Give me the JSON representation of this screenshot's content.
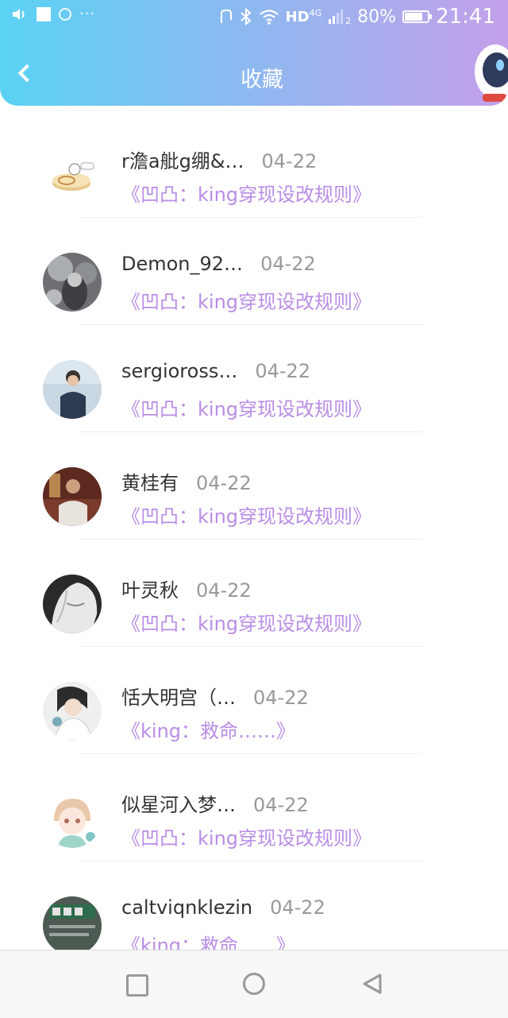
{
  "status_bar": {
    "network": "HD",
    "signal_gen": "4G",
    "sim": "2",
    "battery": "80%",
    "battery_level": 0.8,
    "time": "21:41",
    "icons": [
      "volume-icon",
      "square-app-icon",
      "search-app-icon",
      "more-dots-icon",
      "nfc-icon",
      "bluetooth-icon",
      "wifi-icon",
      "signal-icon",
      "battery-icon"
    ]
  },
  "header": {
    "title": "收藏",
    "back_icon": "chevron-left-icon",
    "mascot": "astronaut-mascot-icon"
  },
  "colors": {
    "header_start": "#5ad2f4",
    "header_end": "#c4a0ea",
    "quote": "#b98de6",
    "name": "#333333",
    "date": "#999999"
  },
  "favorites": [
    {
      "name": "r澹a舭g绷&…",
      "date": "04-22",
      "quote": "《凹凸：king穿现设改规则》",
      "avatar": "cake-roll-avatar"
    },
    {
      "name": "Demon_92…",
      "date": "04-22",
      "quote": "《凹凸：king穿现设改规则》",
      "avatar": "gray-anime-avatar"
    },
    {
      "name": "sergioross…",
      "date": "04-22",
      "quote": "《凹凸：king穿现设改规则》",
      "avatar": "boy-photo-avatar"
    },
    {
      "name": "黄桂有",
      "date": "04-22",
      "quote": "《凹凸：king穿现设改规则》",
      "avatar": "man-photo-avatar"
    },
    {
      "name": "叶灵秋",
      "date": "04-22",
      "quote": "《凹凸：king穿现设改规则》",
      "avatar": "white-hair-anime-avatar"
    },
    {
      "name": "恬大明宫（…",
      "date": "04-22",
      "quote": "《king：救命……》",
      "avatar": "girl-photo-avatar"
    },
    {
      "name": "似星河入梦…",
      "date": "04-22",
      "quote": "《凹凸：king穿现设改规则》",
      "avatar": "chibi-anime-avatar"
    },
    {
      "name": "caltviqnklezin",
      "date": "04-22",
      "quote": "《king：救命……》",
      "avatar": "poster-avatar"
    }
  ],
  "nav_bar": {
    "icons": [
      "recent-apps-icon",
      "home-icon",
      "back-triangle-icon"
    ]
  }
}
